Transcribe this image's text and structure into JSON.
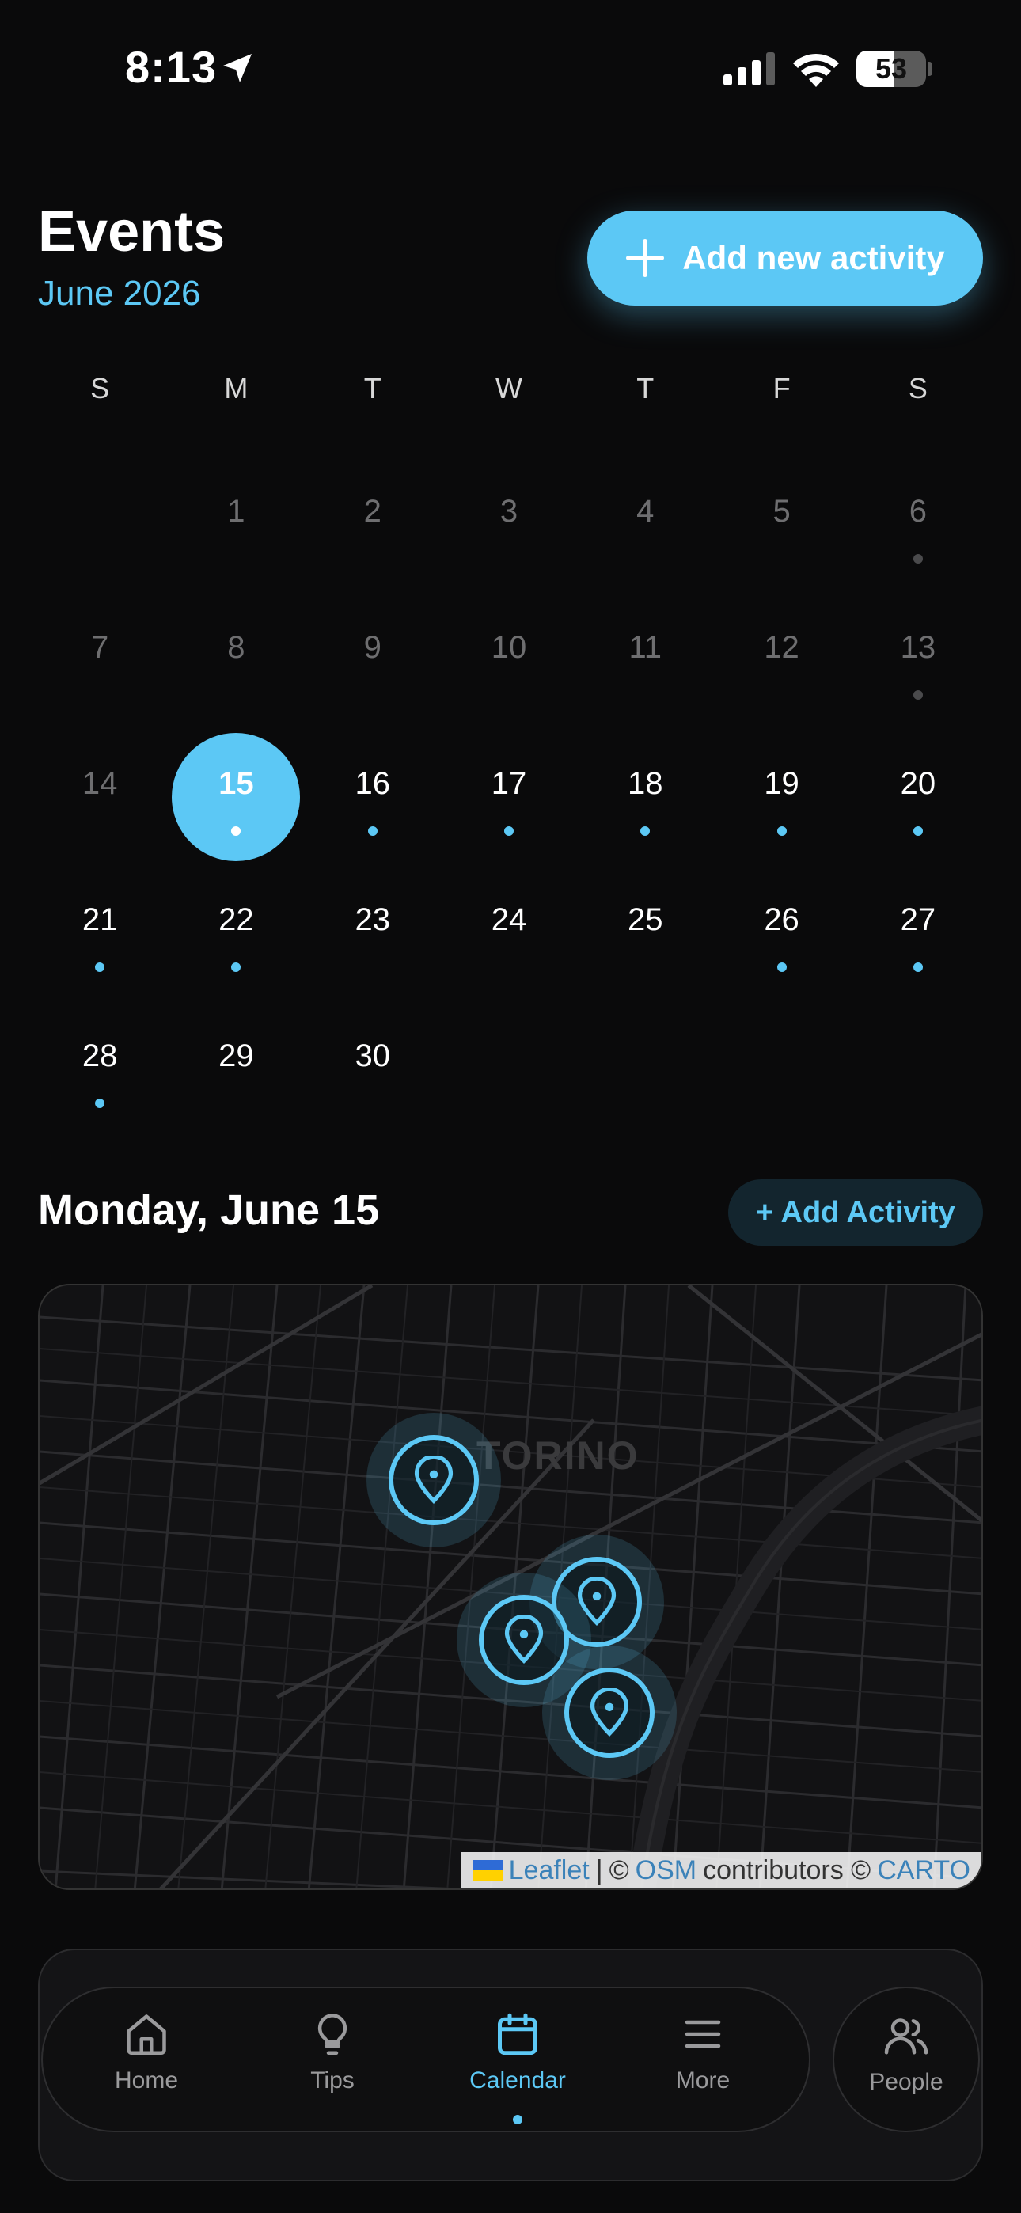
{
  "status_bar": {
    "time": "8:13",
    "battery": "53",
    "battery_level": 0.53
  },
  "header": {
    "title": "Events",
    "month": "June 2026",
    "add_new_label": "Add new activity"
  },
  "calendar": {
    "weekdays": [
      "S",
      "M",
      "T",
      "W",
      "T",
      "F",
      "S"
    ],
    "days": [
      {
        "n": "",
        "state": "blank",
        "dot": false
      },
      {
        "n": "1",
        "state": "past",
        "dot": false
      },
      {
        "n": "2",
        "state": "past",
        "dot": false
      },
      {
        "n": "3",
        "state": "past",
        "dot": false
      },
      {
        "n": "4",
        "state": "past",
        "dot": false
      },
      {
        "n": "5",
        "state": "past",
        "dot": false
      },
      {
        "n": "6",
        "state": "past",
        "dot": true
      },
      {
        "n": "7",
        "state": "past",
        "dot": false
      },
      {
        "n": "8",
        "state": "past",
        "dot": false
      },
      {
        "n": "9",
        "state": "past",
        "dot": false
      },
      {
        "n": "10",
        "state": "past",
        "dot": false
      },
      {
        "n": "11",
        "state": "past",
        "dot": false
      },
      {
        "n": "12",
        "state": "past",
        "dot": false
      },
      {
        "n": "13",
        "state": "past",
        "dot": true
      },
      {
        "n": "14",
        "state": "past",
        "dot": false
      },
      {
        "n": "15",
        "state": "selected",
        "dot": true
      },
      {
        "n": "16",
        "state": "cur",
        "dot": true
      },
      {
        "n": "17",
        "state": "cur",
        "dot": true
      },
      {
        "n": "18",
        "state": "cur",
        "dot": true
      },
      {
        "n": "19",
        "state": "cur",
        "dot": true
      },
      {
        "n": "20",
        "state": "cur",
        "dot": true
      },
      {
        "n": "21",
        "state": "cur",
        "dot": true
      },
      {
        "n": "22",
        "state": "cur",
        "dot": true
      },
      {
        "n": "23",
        "state": "cur",
        "dot": false
      },
      {
        "n": "24",
        "state": "cur",
        "dot": false
      },
      {
        "n": "25",
        "state": "cur",
        "dot": false
      },
      {
        "n": "26",
        "state": "cur",
        "dot": true
      },
      {
        "n": "27",
        "state": "cur",
        "dot": true
      },
      {
        "n": "28",
        "state": "cur",
        "dot": true
      },
      {
        "n": "29",
        "state": "cur",
        "dot": false
      },
      {
        "n": "30",
        "state": "cur",
        "dot": false
      }
    ]
  },
  "day_section": {
    "heading": "Monday, June 15",
    "add_activity_label": "+ Add Activity"
  },
  "map": {
    "city_label": "TORINO",
    "pins": 4,
    "attribution": {
      "leaflet": "Leaflet",
      "sep": "|",
      "copy1": "©",
      "osm": "OSM",
      "contributors": "contributors ©",
      "carto": "CARTO"
    }
  },
  "tabbar": {
    "home": "Home",
    "tips": "Tips",
    "calendar": "Calendar",
    "more": "More",
    "people": "People"
  },
  "colors": {
    "accent": "#5cc8f5",
    "background": "#0a0a0b"
  }
}
